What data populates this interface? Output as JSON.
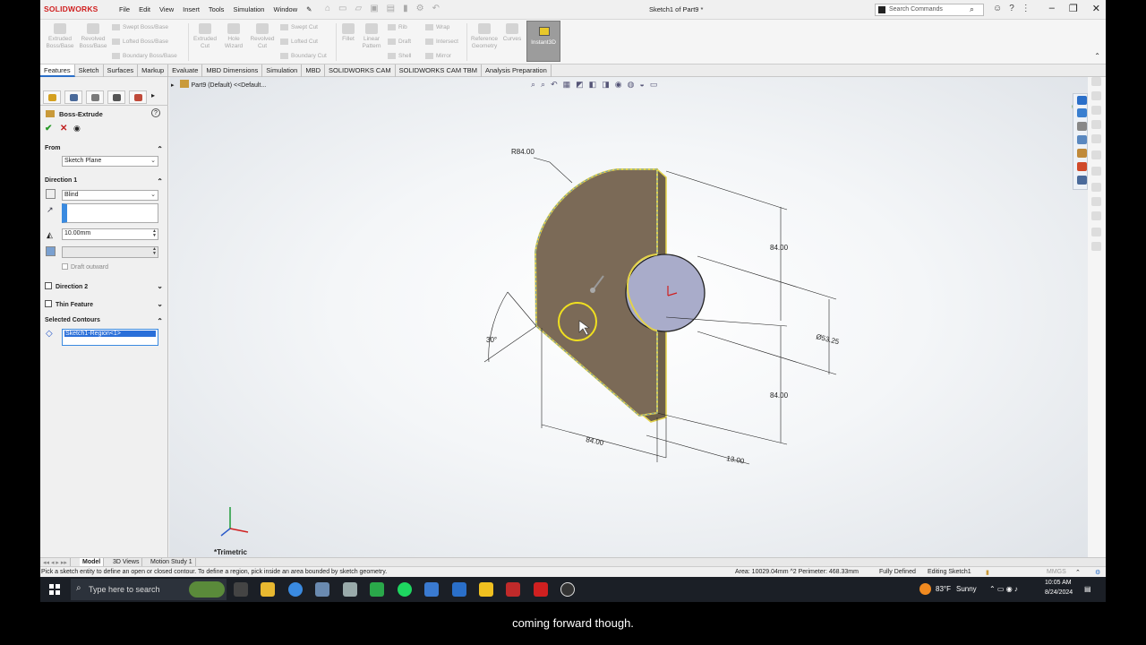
{
  "app": {
    "logo": "SOLIDWORKS",
    "doc_title": "Sketch1 of Part9 *"
  },
  "menu": [
    "File",
    "Edit",
    "View",
    "Insert",
    "Tools",
    "Simulation",
    "Window"
  ],
  "search": {
    "placeholder": "Search Commands"
  },
  "ribbon": {
    "buttons": [
      {
        "name": "extruded-boss-button",
        "label1": "Extruded",
        "label2": "Boss/Base"
      },
      {
        "name": "revolved-boss-button",
        "label1": "Revolved",
        "label2": "Boss/Base"
      },
      {
        "name": "extruded-cut-button",
        "label1": "Extruded",
        "label2": "Cut"
      },
      {
        "name": "hole-wizard-button",
        "label1": "Hole",
        "label2": "Wizard"
      },
      {
        "name": "revolved-cut-button",
        "label1": "Revolved",
        "label2": "Cut"
      },
      {
        "name": "fillet-button",
        "label1": "Fillet",
        "label2": ""
      },
      {
        "name": "linear-pattern-button",
        "label1": "Linear",
        "label2": "Pattern"
      },
      {
        "name": "reference-geometry-button",
        "label1": "Reference",
        "label2": "Geometry"
      },
      {
        "name": "curves-button",
        "label1": "Curves",
        "label2": ""
      }
    ],
    "small": [
      {
        "name": "swept-boss-button",
        "label": "Swept Boss/Base"
      },
      {
        "name": "lofted-boss-button",
        "label": "Lofted Boss/Base"
      },
      {
        "name": "boundary-boss-button",
        "label": "Boundary Boss/Base"
      },
      {
        "name": "swept-cut-button",
        "label": "Swept Cut"
      },
      {
        "name": "lofted-cut-button",
        "label": "Lofted Cut"
      },
      {
        "name": "boundary-cut-button",
        "label": "Boundary Cut"
      },
      {
        "name": "rib-button",
        "label": "Rib"
      },
      {
        "name": "draft-button",
        "label": "Draft"
      },
      {
        "name": "shell-button",
        "label": "Shell"
      },
      {
        "name": "wrap-button",
        "label": "Wrap"
      },
      {
        "name": "intersect-button",
        "label": "Intersect"
      },
      {
        "name": "mirror-button",
        "label": "Mirror"
      }
    ],
    "instant3d": "Instant3D"
  },
  "tabs": [
    "Features",
    "Sketch",
    "Surfaces",
    "Markup",
    "Evaluate",
    "MBD Dimensions",
    "Simulation",
    "MBD",
    "SOLIDWORKS CAM",
    "SOLIDWORKS CAM TBM",
    "Analysis Preparation"
  ],
  "panel": {
    "title": "Boss-Extrude",
    "from_label": "From",
    "from_value": "Sketch Plane",
    "dir1_label": "Direction 1",
    "dir1_value": "Blind",
    "depth": "10.00mm",
    "draft_outward": "Draft outward",
    "dir2_label": "Direction 2",
    "thin_label": "Thin Feature",
    "contours_label": "Selected Contours",
    "contour_item": "Sketch1-Region<1>"
  },
  "tree": {
    "label": "Part9 (Default) <<Default..."
  },
  "dims": {
    "r84": "R84.00",
    "d84a": "84.00",
    "d84b": "84.00",
    "d84c": "84.00",
    "dia": "Ø53.25",
    "d13": "13.00",
    "ang": "30°"
  },
  "view_label": "*Trimetric",
  "bottom_tabs": [
    "Model",
    "3D Views",
    "Motion Study 1"
  ],
  "status": {
    "hint": "Pick a sketch entity to define an open or closed contour. To define a region, pick inside an area bounded by sketch geometry.",
    "area": "Area: 10029.04mm ^2 Perimeter: 468.33mm",
    "defined": "Fully Defined",
    "editing": "Editing Sketch1",
    "units": "MMGS"
  },
  "taskbar": {
    "search": "Type here to search",
    "temp": "83°F",
    "weather": "Sunny",
    "time": "10:05 AM",
    "date": "8/24/2024"
  },
  "caption": "coming forward though."
}
